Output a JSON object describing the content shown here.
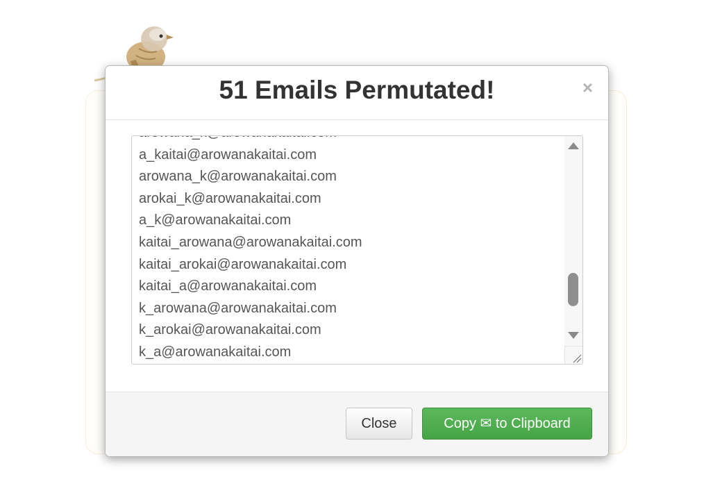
{
  "modal": {
    "title": "51 Emails Permutated!",
    "close_symbol": "×",
    "emails": [
      "arowana_k@arowanakaitai.com",
      "a_kaitai@arowanakaitai.com",
      "arowana_k@arowanakaitai.com",
      "arokai_k@arowanakaitai.com",
      "a_k@arowanakaitai.com",
      "kaitai_arowana@arowanakaitai.com",
      "kaitai_arokai@arowanakaitai.com",
      "kaitai_a@arowanakaitai.com",
      "k_arowana@arowanakaitai.com",
      "k_arokai@arowanakaitai.com",
      "k_a@arowanakaitai.com"
    ],
    "scroll_position": 0.85,
    "footer": {
      "close_label": "Close",
      "copy_label": "Copy ✉ to Clipboard"
    }
  },
  "icons": {
    "mascot": "bird-icon",
    "scroll_up": "triangle-up-icon",
    "scroll_down": "triangle-down-icon",
    "resize": "resize-grip-icon",
    "envelope": "envelope-icon"
  },
  "colors": {
    "copy_button": "#4cae4c",
    "title_text": "#333333",
    "email_text": "#555555"
  }
}
